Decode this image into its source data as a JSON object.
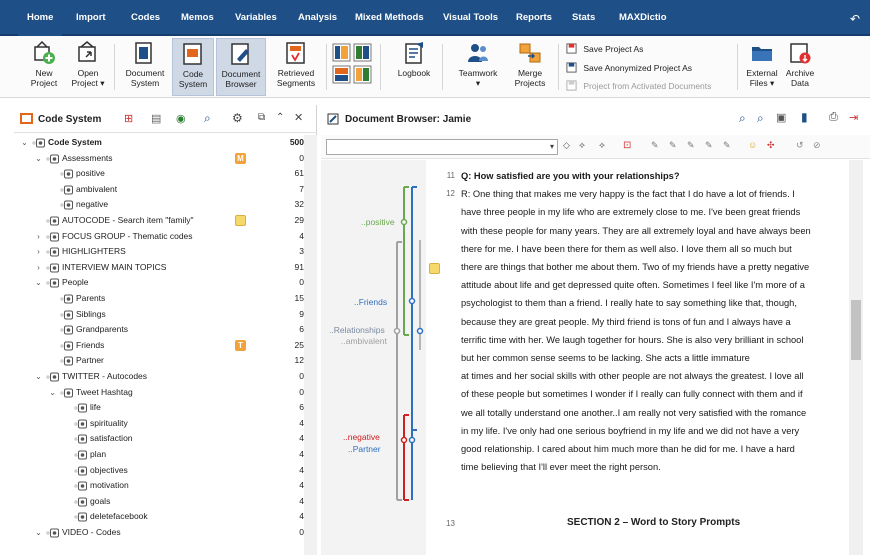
{
  "menu": {
    "items": [
      "Home",
      "Import",
      "Codes",
      "Memos",
      "Variables",
      "Analysis",
      "Mixed Methods",
      "Visual Tools",
      "Reports",
      "Stats",
      "MAXDictio"
    ],
    "active": "Home"
  },
  "ribbon": {
    "new_project": [
      "New",
      "Project"
    ],
    "open_project": [
      "Open",
      "Project ▾"
    ],
    "document_system": [
      "Document",
      "System"
    ],
    "code_system": [
      "Code",
      "System"
    ],
    "document_browser": [
      "Document",
      "Browser"
    ],
    "retrieved_segments": [
      "Retrieved",
      "Segments"
    ],
    "logbook": "Logbook",
    "teamwork": [
      "Teamwork",
      "▾"
    ],
    "merge_projects": [
      "Merge",
      "Projects"
    ],
    "save_project_as": "Save Project As",
    "save_anonymized": "Save Anonymized Project As",
    "project_from_activated": "Project from Activated Documents",
    "external_files": [
      "External",
      "Files ▾"
    ],
    "archive_data": [
      "Archive",
      "Data"
    ]
  },
  "code_system": {
    "title": "Code System",
    "rows": [
      {
        "label": "Code System",
        "count": "500",
        "level": 0,
        "toggle": "open",
        "bold": true,
        "memo": ""
      },
      {
        "label": "Assessments",
        "count": "0",
        "level": 1,
        "toggle": "open",
        "memo": "M"
      },
      {
        "label": "positive",
        "count": "61",
        "level": 2,
        "toggle": "",
        "memo": ""
      },
      {
        "label": "ambivalent",
        "count": "7",
        "level": 2,
        "toggle": "",
        "memo": ""
      },
      {
        "label": "negative",
        "count": "32",
        "level": 2,
        "toggle": "",
        "memo": ""
      },
      {
        "label": "AUTOCODE - Search item \"family\"",
        "count": "29",
        "level": 1,
        "toggle": "",
        "memo": "Y"
      },
      {
        "label": "FOCUS GROUP - Thematic codes",
        "count": "4",
        "level": 1,
        "toggle": "closed",
        "memo": ""
      },
      {
        "label": "HIGHLIGHTERS",
        "count": "3",
        "level": 1,
        "toggle": "closed",
        "memo": ""
      },
      {
        "label": "INTERVIEW MAIN TOPICS",
        "count": "91",
        "level": 1,
        "toggle": "closed",
        "memo": ""
      },
      {
        "label": "People",
        "count": "0",
        "level": 1,
        "toggle": "open",
        "memo": ""
      },
      {
        "label": "Parents",
        "count": "15",
        "level": 2,
        "toggle": "",
        "memo": ""
      },
      {
        "label": "Siblings",
        "count": "9",
        "level": 2,
        "toggle": "",
        "memo": ""
      },
      {
        "label": "Grandparents",
        "count": "6",
        "level": 2,
        "toggle": "",
        "memo": ""
      },
      {
        "label": "Friends",
        "count": "25",
        "level": 2,
        "toggle": "",
        "memo": "T"
      },
      {
        "label": "Partner",
        "count": "12",
        "level": 2,
        "toggle": "",
        "memo": ""
      },
      {
        "label": "TWITTER - Autocodes",
        "count": "0",
        "level": 1,
        "toggle": "open",
        "memo": ""
      },
      {
        "label": "Tweet Hashtag",
        "count": "0",
        "level": 2,
        "toggle": "open",
        "memo": ""
      },
      {
        "label": "life",
        "count": "6",
        "level": 3,
        "toggle": "",
        "memo": ""
      },
      {
        "label": "spirituality",
        "count": "4",
        "level": 3,
        "toggle": "",
        "memo": ""
      },
      {
        "label": "satisfaction",
        "count": "4",
        "level": 3,
        "toggle": "",
        "memo": ""
      },
      {
        "label": "plan",
        "count": "4",
        "level": 3,
        "toggle": "",
        "memo": ""
      },
      {
        "label": "objectives",
        "count": "4",
        "level": 3,
        "toggle": "",
        "memo": ""
      },
      {
        "label": "motivation",
        "count": "4",
        "level": 3,
        "toggle": "",
        "memo": ""
      },
      {
        "label": "goals",
        "count": "4",
        "level": 3,
        "toggle": "",
        "memo": ""
      },
      {
        "label": "deletefacebook",
        "count": "4",
        "level": 3,
        "toggle": "",
        "memo": ""
      },
      {
        "label": "VIDEO - Codes",
        "count": "0",
        "level": 1,
        "toggle": "open",
        "memo": ""
      }
    ]
  },
  "document_browser": {
    "title": "Document Browser: Jamie",
    "codes": {
      "positive": "..positive",
      "friends": "..Friends",
      "relationships": "..Relationships",
      "ambivalent": "..ambivalent",
      "negative": "..negative",
      "partner": "..Partner"
    },
    "line_numbers": [
      "11",
      "12",
      "13"
    ],
    "lines": [
      {
        "text": "Q: How satisfied are you with your relationships?",
        "bold": true
      },
      {
        "text": "R: One thing that makes me very happy is the fact that I do have a lot of friends. I",
        "bold": false
      },
      {
        "text": "have three people in my life who are extremely close to me. I've been great friends",
        "bold": false
      },
      {
        "text": "with these people for many years. They are all extremely loyal and have always been",
        "bold": false
      },
      {
        "text": "there for me. I have been there for them as well also. I love them all so much but",
        "bold": false
      },
      {
        "text": "there are things that bother me about them. Two of my friends have a pretty negative",
        "bold": false
      },
      {
        "text": "attitude about life and get depressed quite often. Sometimes I feel like I'm more of a",
        "bold": false
      },
      {
        "text": "psychologist to them than a friend. I really hate to say something like that, though,",
        "bold": false
      },
      {
        "text": "because they are great people. My third friend is tons of fun and I always have a",
        "bold": false
      },
      {
        "text": "terrific time with her. We laugh together for hours. She is also very brilliant in school",
        "bold": false
      },
      {
        "text": "but her common sense seems to be lacking. She acts a little immature",
        "bold": false
      },
      {
        "text": "at times and her social skills with other people are not always the greatest. I love all",
        "bold": false
      },
      {
        "text": "of these people but sometimes I wonder if I really can fully connect with them and if",
        "bold": false
      },
      {
        "text": "we all totally understand one another..I am really not very satisfied with the romance",
        "bold": false
      },
      {
        "text": "in my life. I've only had one serious boyfriend in my life and we did not have a very",
        "bold": false
      },
      {
        "text": "good relationship. I cared about him much more than he did for me. I have a hard",
        "bold": false
      },
      {
        "text": "time believing that I'll ever meet the right person.",
        "bold": false
      }
    ],
    "section_heading": "SECTION 2 – Word to Story Prompts"
  },
  "colors": {
    "menubar": "#1e4f86",
    "positive": "#6aa84f",
    "friends": "#2e6fc0",
    "ambivalent": "#a0a0a0",
    "negative": "#cc2222",
    "memo_yellow": "#f6d86b",
    "memo_orange": "#f2a23a"
  }
}
